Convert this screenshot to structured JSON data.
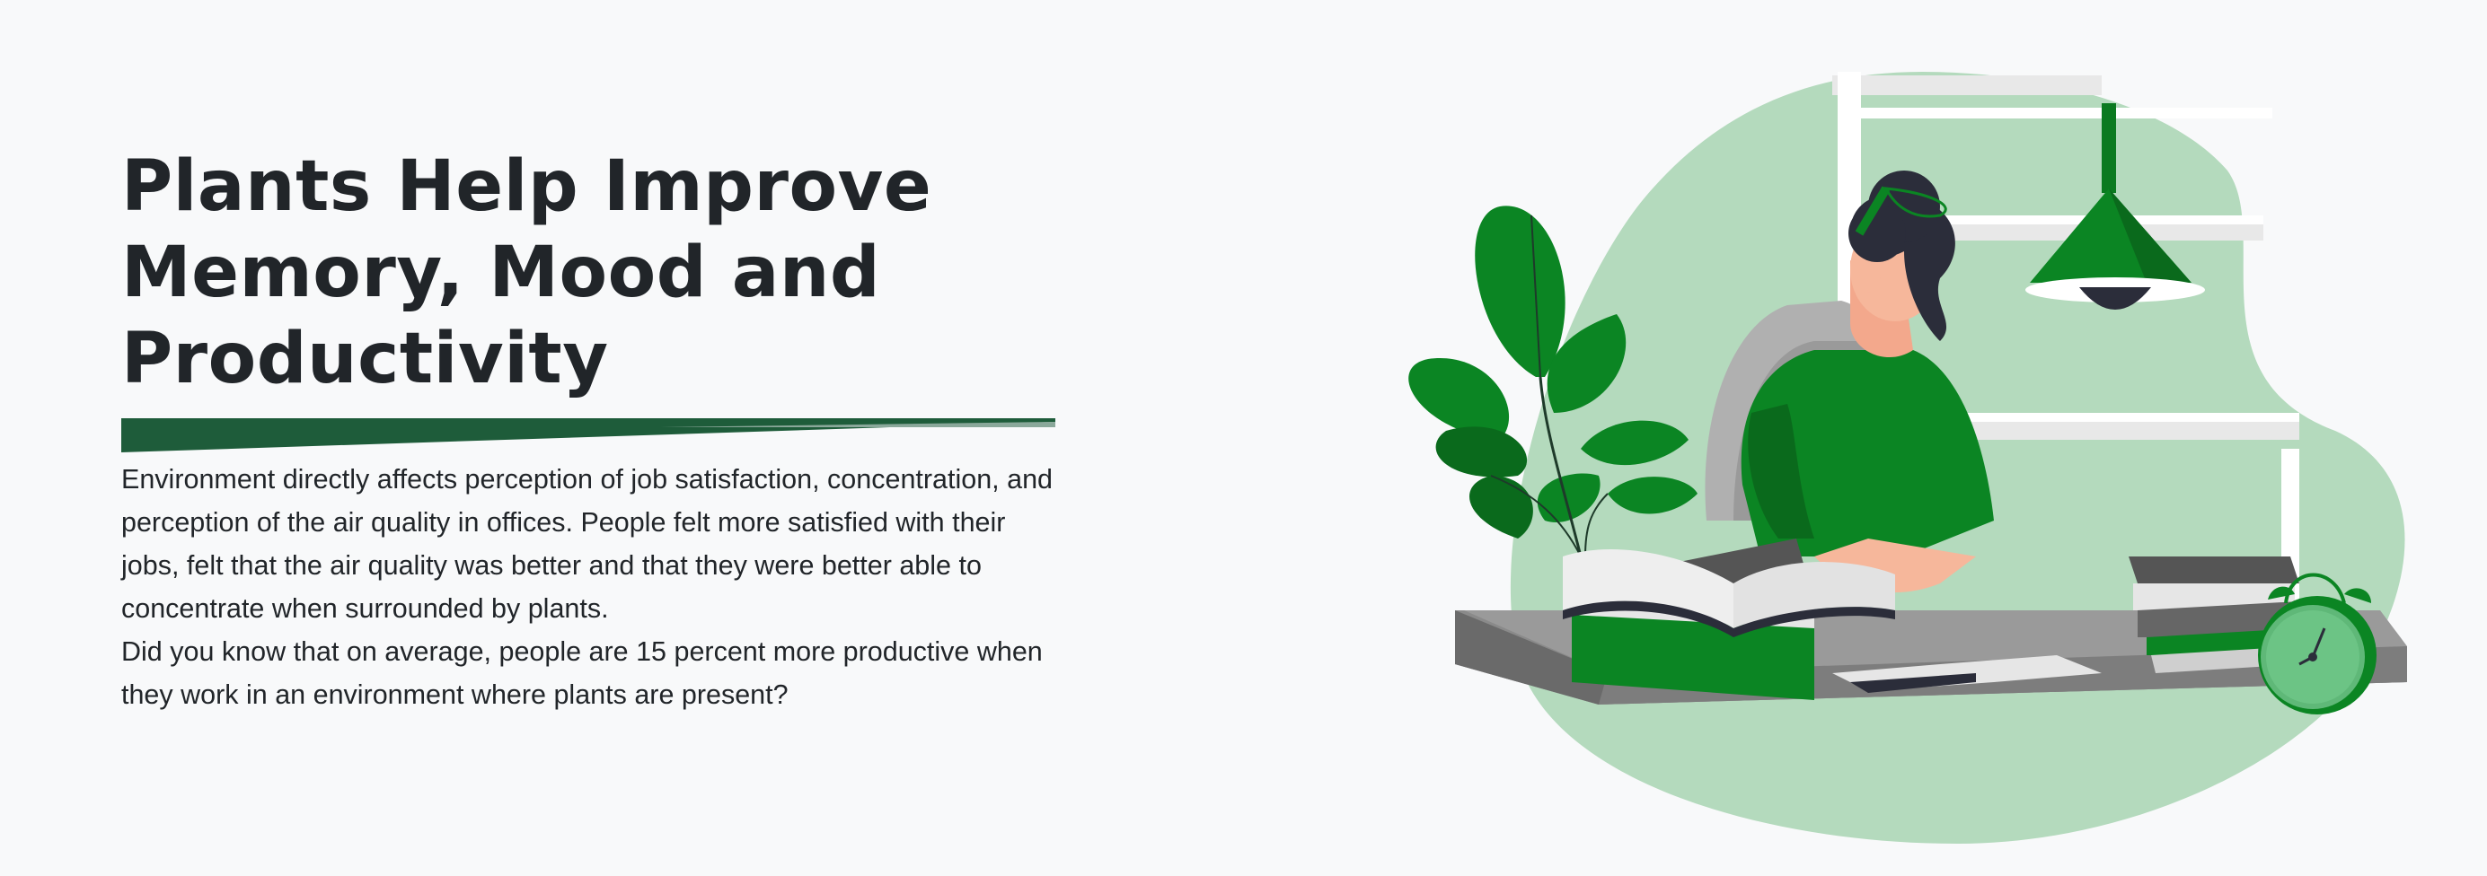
{
  "hero": {
    "headline_lines": [
      "Plants Help Improve",
      "Memory, Mood and",
      "Productivity"
    ],
    "paragraphs": [
      "Environment directly affects perception of job satisfaction, concentration, and perception of the air quality in offices. People felt more satisfied with their jobs, felt that the air quality was better and that they were better able to concentrate when surrounded by plants.",
      "Did you know that on average, people are 15 percent more productive when they work in an environment where plants are present?"
    ]
  },
  "colors": {
    "background": "#f8f9fa",
    "text": "#212529",
    "accent_dark_green": "#1e5c3a",
    "plant_green": "#0b8523",
    "blob_light_green": "#b4dabd"
  },
  "illustration": {
    "icons": [
      "plant-icon",
      "lamp-icon",
      "window-icon",
      "desk-icon",
      "book-icon",
      "alarm-clock-icon",
      "woman-reading-icon"
    ]
  }
}
